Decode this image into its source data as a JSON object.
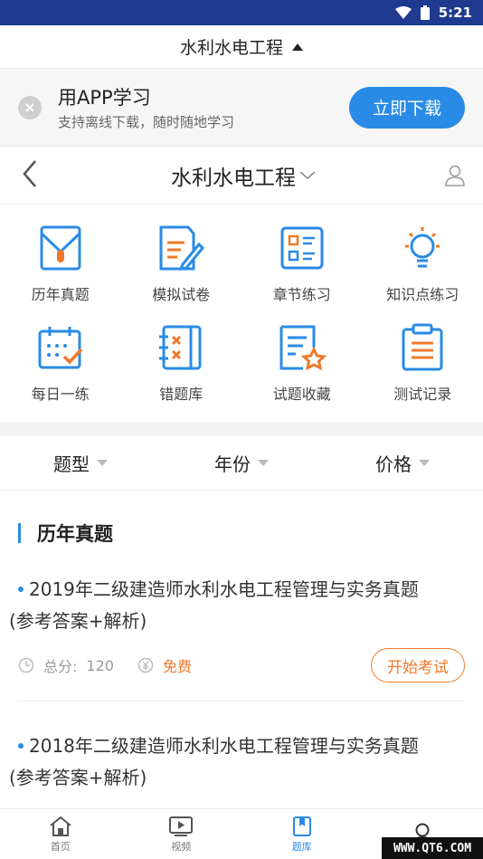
{
  "status_bar": {
    "time": "5:21"
  },
  "top_title": {
    "label": "水利水电工程"
  },
  "app_banner": {
    "title": "用APP学习",
    "subtitle": "支持离线下载，随时随地学习",
    "download_label": "立即下载"
  },
  "nav": {
    "title": "水利水电工程"
  },
  "grid": [
    {
      "label": "历年真题",
      "icon": "folder-icon"
    },
    {
      "label": "模拟试卷",
      "icon": "paper-pen-icon"
    },
    {
      "label": "章节练习",
      "icon": "checklist-icon"
    },
    {
      "label": "知识点练习",
      "icon": "lightbulb-icon"
    },
    {
      "label": "每日一练",
      "icon": "calendar-check-icon"
    },
    {
      "label": "错题库",
      "icon": "wrong-book-icon"
    },
    {
      "label": "试题收藏",
      "icon": "doc-star-icon"
    },
    {
      "label": "测试记录",
      "icon": "clipboard-icon"
    }
  ],
  "filters": [
    {
      "label": "题型"
    },
    {
      "label": "年份"
    },
    {
      "label": "价格"
    }
  ],
  "section": {
    "title": "历年真题"
  },
  "exams": [
    {
      "title": "2019年二级建造师水利水电工程管理与实务真题",
      "title_line2": "(参考答案+解析)",
      "score_label": "总分:",
      "score": "120",
      "price": "免费",
      "start_label": "开始考试"
    },
    {
      "title": "2018年二级建造师水利水电工程管理与实务真题",
      "title_line2": "(参考答案+解析)"
    }
  ],
  "tabs": [
    {
      "label": "首页",
      "icon": "home-icon"
    },
    {
      "label": "视频",
      "icon": "video-icon"
    },
    {
      "label": "题库",
      "icon": "bookmark-icon"
    },
    {
      "label": "",
      "icon": "user-icon"
    }
  ],
  "watermark": "WWW.QT6.COM",
  "colors": {
    "status_bar": "#1f3a8f",
    "accent_blue": "#2a8be6",
    "accent_orange": "#ef7a2a"
  }
}
